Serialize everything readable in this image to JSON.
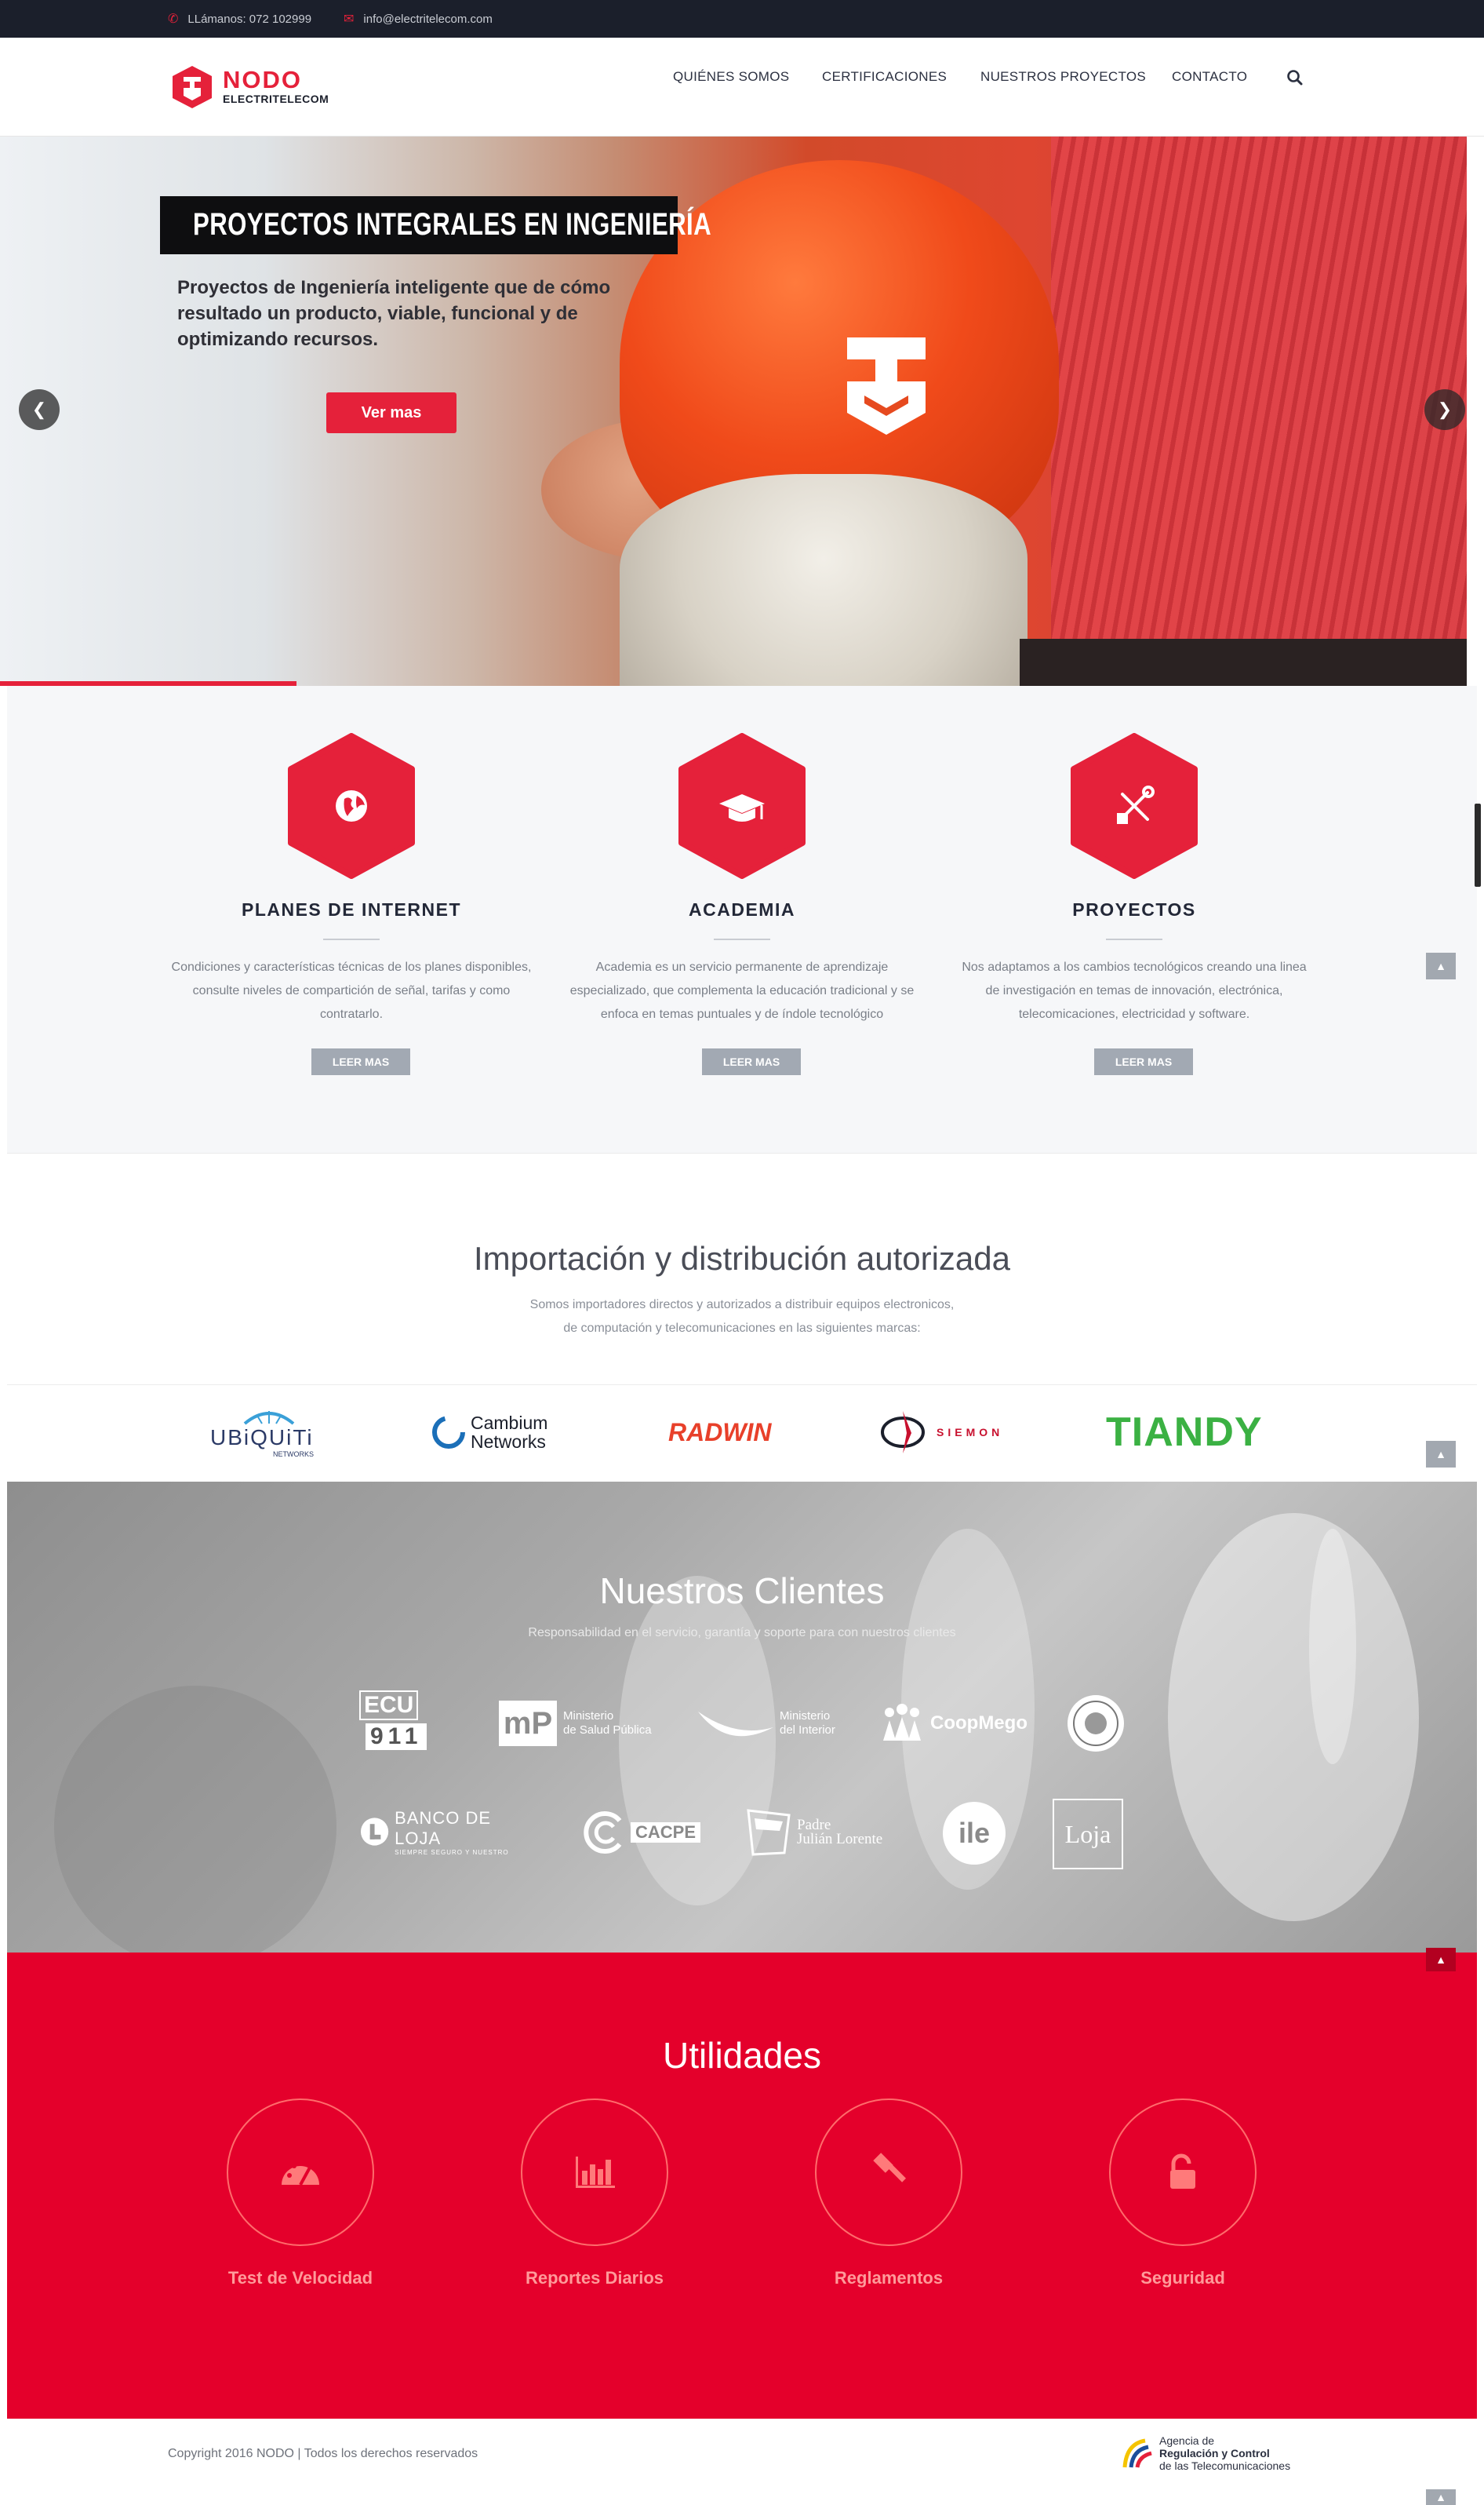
{
  "topbar": {
    "phone": "LLámanos: 072 102999",
    "email": "info@electritelecom.com"
  },
  "header": {
    "logo_top": "NODO",
    "logo_bottom": "ELECTRITELECOM",
    "nav": [
      "QUIÉNES SOMOS",
      "CERTIFICACIONES",
      "NUESTROS PROYECTOS",
      "CONTACTO"
    ]
  },
  "hero": {
    "title": "PROYECTOS INTEGRALES EN INGENIERÍA",
    "text": "Proyectos de Ingeniería inteligente que de cómo resultado un producto, viable, funcional y de optimizando recursos.",
    "button": "Ver mas",
    "slide_progress": 0.2
  },
  "services": [
    {
      "title": "PLANES DE INTERNET",
      "text": "Condiciones y características técnicas de los planes disponibles, consulte niveles de compartición de señal, tarifas y como contratarlo.",
      "button": "LEER MAS",
      "icon": "globe-icon"
    },
    {
      "title": "ACADEMIA",
      "text": "Academia es un servicio permanente de aprendizaje especializado, que complementa la educación tradicional y se enfoca en temas puntuales y de índole tecnológico",
      "button": "LEER MAS",
      "icon": "graduation-cap-icon"
    },
    {
      "title": "PROYECTOS",
      "text": "Nos adaptamos a los cambios tecnológicos creando una linea de investigación en temas de innovación, electrónica, telecomicaciones, electricidad y software.",
      "button": "LEER MAS",
      "icon": "tools-icon"
    }
  ],
  "brands": {
    "title": "Importación y distribución autorizada",
    "subtitle_line1": "Somos importadores directos y autorizados a distribuir equipos electronicos,",
    "subtitle_line2": "de computación y telecomunicaciones en las siguientes marcas:",
    "items": [
      {
        "name": "UBiQUiTi",
        "sub": "NETWORKS",
        "color": "#2b3a66"
      },
      {
        "name": "Cambium",
        "sub": "Networks",
        "color": "#1b1f2b"
      },
      {
        "name": "RADWIN",
        "sub": "",
        "color": "#e8402a"
      },
      {
        "name": "SIEMON",
        "sub": "",
        "color": "#c8102e"
      },
      {
        "name": "TIANDY",
        "sub": "",
        "color": "#3bb143"
      }
    ]
  },
  "clients": {
    "title": "Nuestros Clientes",
    "subtitle": "Responsabilidad en el servicio, garantía y soporte para con nuestros clientes",
    "row1": [
      {
        "line1": "ECU",
        "line2": "911"
      },
      {
        "line1": "Ministerio",
        "line2": "de Salud Pública"
      },
      {
        "line1": "Ministerio",
        "line2": "del Interior"
      },
      {
        "line1": "CoopMego",
        "line2": ""
      },
      {
        "line1": "",
        "line2": ""
      }
    ],
    "row2": [
      {
        "line1": "BANCO DE LOJA",
        "line2": "SIEMPRE SEGURO Y NUESTRO"
      },
      {
        "line1": "CACPE",
        "line2": ""
      },
      {
        "line1": "Padre",
        "line2": "Julián Lorente"
      },
      {
        "line1": "ile",
        "line2": ""
      },
      {
        "line1": "Loja",
        "line2": ""
      }
    ]
  },
  "utilities": {
    "title": "Utilidades",
    "items": [
      {
        "label": "Test de Velocidad",
        "icon": "speedometer-icon"
      },
      {
        "label": "Reportes Diarios",
        "icon": "bar-chart-icon"
      },
      {
        "label": "Reglamentos",
        "icon": "gavel-icon"
      },
      {
        "label": "Seguridad",
        "icon": "unlock-icon"
      }
    ]
  },
  "footer": {
    "copyright": "Copyright 2016  NODO  |  Todos los derechos reservados",
    "agency_line1": "Agencia de",
    "agency_line2": "Regulación y Control",
    "agency_line3": "de las Telecomunicaciones"
  },
  "colors": {
    "accent": "#e5213a",
    "dark": "#1b1f2b",
    "utilities_bg": "#e4002b"
  }
}
